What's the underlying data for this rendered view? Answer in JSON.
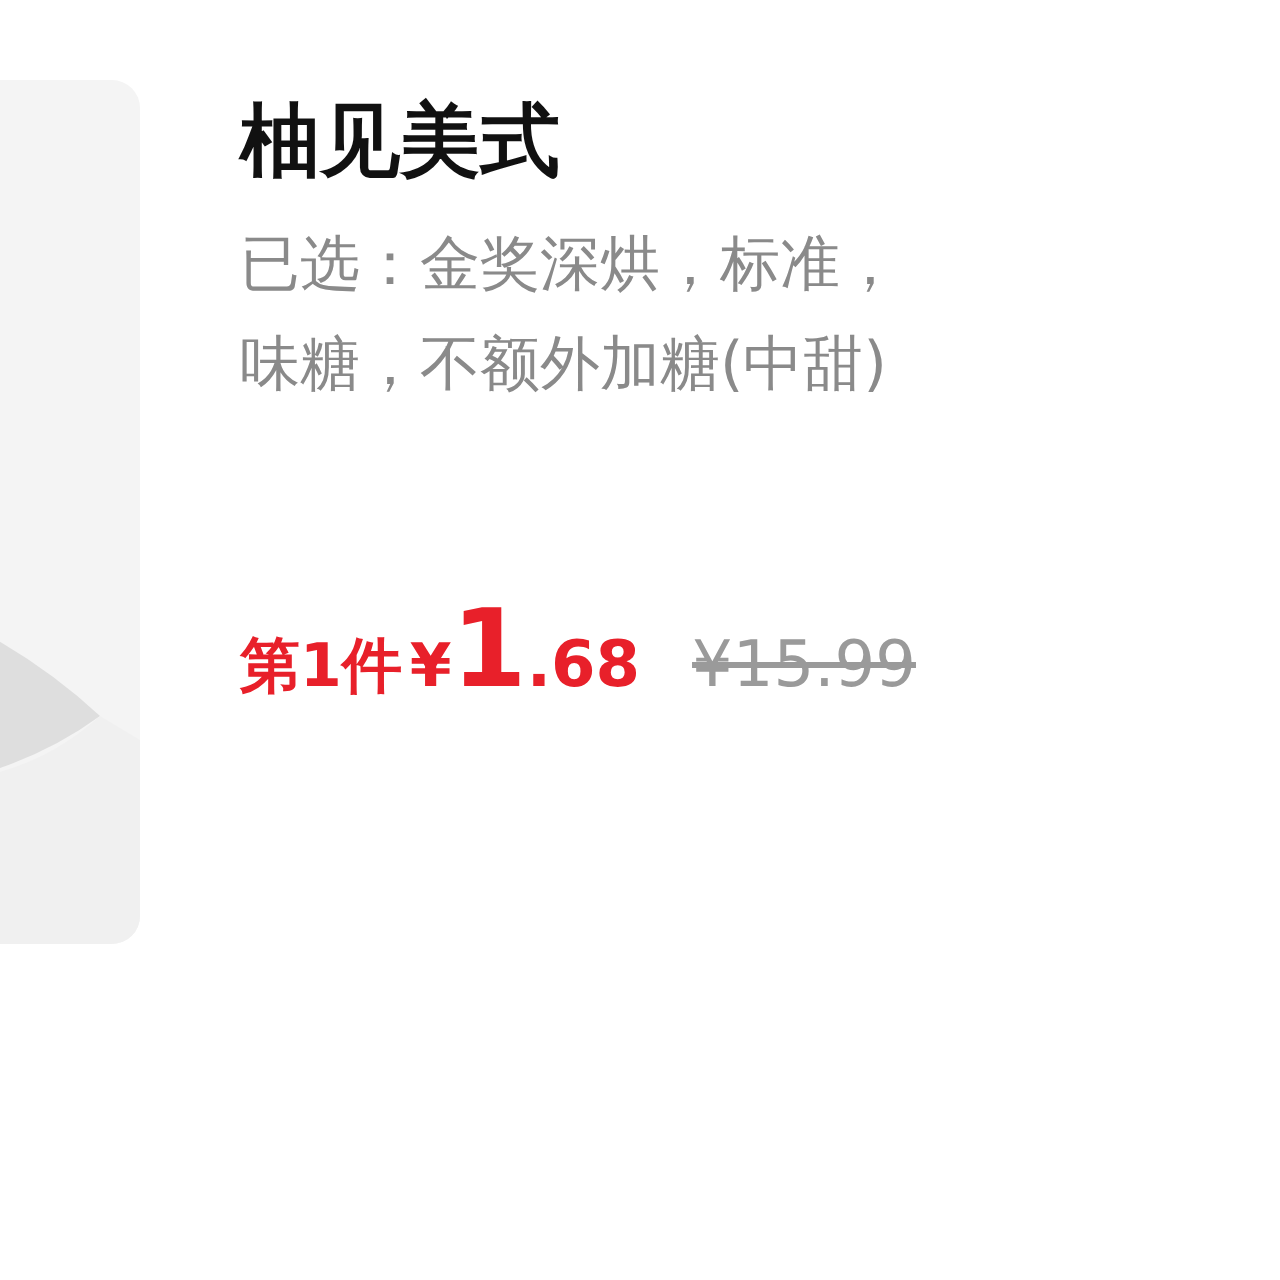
{
  "product": {
    "name": "柚见美式",
    "options_lines": [
      "已选：金奖深烘，标准，",
      "味糖，不额外加糖(中甜)"
    ],
    "price": {
      "label": "第1件",
      "currency": "¥",
      "integer": "1",
      "decimal": ".68",
      "original": "¥15.99"
    }
  }
}
